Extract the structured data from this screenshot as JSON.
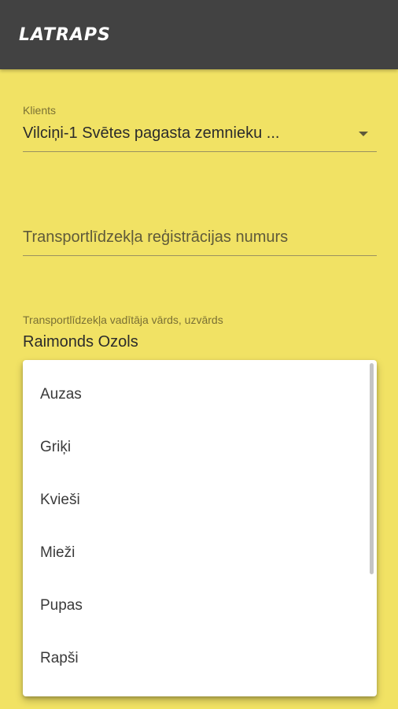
{
  "header": {
    "logo_text": "LATRAPS"
  },
  "form": {
    "client": {
      "label": "Klients",
      "value": "Vilciņi-1 Svētes pagasta zemnieku ..."
    },
    "registration": {
      "placeholder": "Transportlīdzekļa reģistrācijas numurs"
    },
    "driver": {
      "label": "Transportlīdzekļa vadītāja vārds, uzvārds",
      "value": "Raimonds Ozols"
    }
  },
  "dropdown": {
    "options": [
      "Auzas",
      "Griķi",
      "Kvieši",
      "Mieži",
      "Pupas",
      "Rapši"
    ]
  },
  "colors": {
    "background": "#f1e264",
    "appbar": "#424242",
    "menu": "#ffffff"
  }
}
